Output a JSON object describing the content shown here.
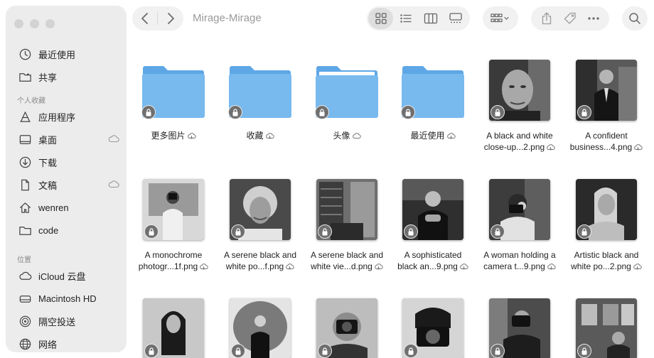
{
  "window": {
    "title": "Mirage-Mirage"
  },
  "sidebar": {
    "items_top": [
      {
        "label": "最近使用",
        "icon": "clock-icon"
      },
      {
        "label": "共享",
        "icon": "shared-folder-icon"
      }
    ],
    "favorites_header": "个人收藏",
    "favorites": [
      {
        "label": "应用程序",
        "icon": "applications-icon"
      },
      {
        "label": "桌面",
        "icon": "desktop-icon"
      },
      {
        "label": "下载",
        "icon": "download-icon"
      },
      {
        "label": "文稿",
        "icon": "document-icon"
      },
      {
        "label": "wenren",
        "icon": "home-icon"
      },
      {
        "label": "code",
        "icon": "folder-icon"
      }
    ],
    "locations_header": "位置",
    "locations": [
      {
        "label": "iCloud 云盘",
        "icon": "icloud-icon"
      },
      {
        "label": "Macintosh HD",
        "icon": "drive-icon"
      },
      {
        "label": "隔空投送",
        "icon": "airdrop-icon"
      },
      {
        "label": "网络",
        "icon": "network-icon"
      }
    ]
  },
  "toolbar": {
    "back": "chevron-left-icon",
    "forward": "chevron-right-icon",
    "views": [
      "grid-view-icon",
      "list-view-icon",
      "column-view-icon",
      "gallery-view-icon"
    ],
    "active_view": "grid-view-icon",
    "group": "group-by-icon",
    "actions": [
      "share-icon",
      "tag-icon",
      "more-icon"
    ],
    "search": "search-icon"
  },
  "files": [
    {
      "line1": "更多图片",
      "line2": ""
    },
    {
      "line1": "收藏",
      "line2": ""
    },
    {
      "line1": "头像",
      "line2": ""
    },
    {
      "line1": "最近使用",
      "line2": ""
    },
    {
      "line1": "A black and white",
      "line2": "close-up...2.png"
    },
    {
      "line1": "A confident",
      "line2": "business...4.png"
    },
    {
      "line1": "A monochrome",
      "line2": "photogr...1f.png"
    },
    {
      "line1": "A serene black and",
      "line2": "white po...f.png"
    },
    {
      "line1": "A serene black and",
      "line2": "white vie...d.png"
    },
    {
      "line1": "A sophisticated",
      "line2": "black an...9.png"
    },
    {
      "line1": "A woman holding a",
      "line2": "camera t...9.png"
    },
    {
      "line1": "Artistic black and",
      "line2": "white po...2.png"
    }
  ],
  "colors": {
    "folder": "#74b6ec",
    "folder_tab": "#5ea7e6",
    "sidebar": "#ececec",
    "pill": "#f1f1f1"
  }
}
